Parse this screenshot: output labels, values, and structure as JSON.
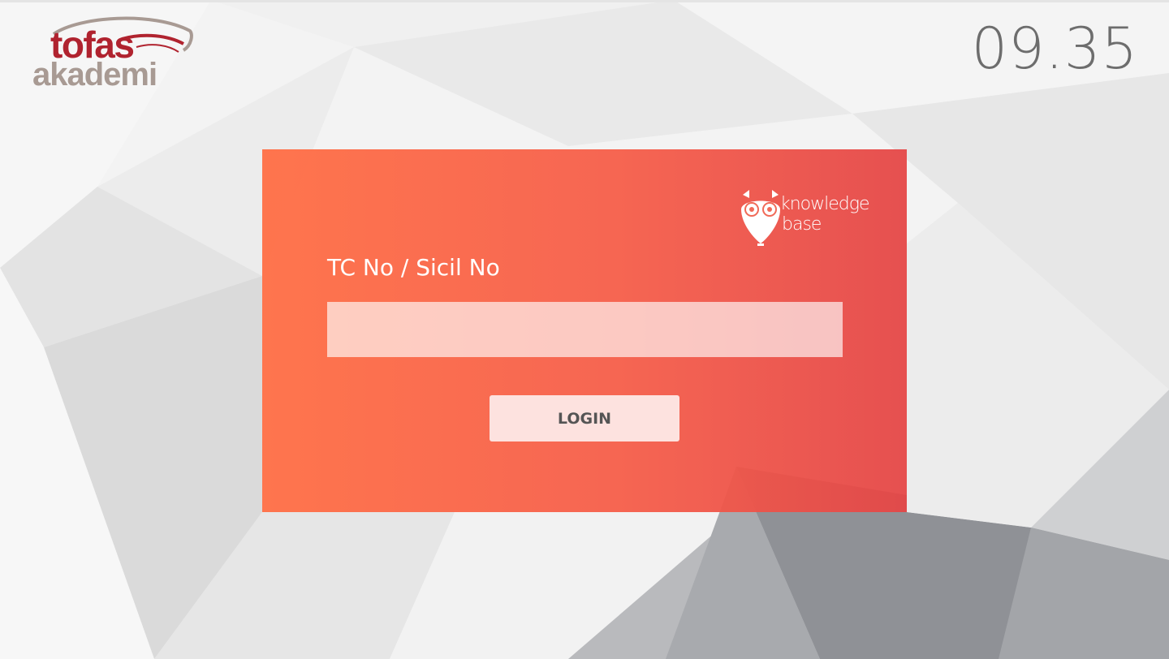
{
  "header": {
    "logo": {
      "word1": "tofas",
      "word2": "akademi",
      "brand_red": "#b0232f",
      "brand_taupe": "#a89a93"
    },
    "clock": "09.35"
  },
  "login": {
    "kb_logo": {
      "line1": "knowledge",
      "line2": "base",
      "icon": "owl-icon"
    },
    "field_label": "TC No / Sicil No",
    "input_value": "",
    "button_label": "LOGIN"
  },
  "colors": {
    "card_start": "#ff7148",
    "card_end": "#e54646",
    "button_bg": "#fde2df",
    "button_text": "#555555",
    "clock_text": "#6d6d6d"
  }
}
